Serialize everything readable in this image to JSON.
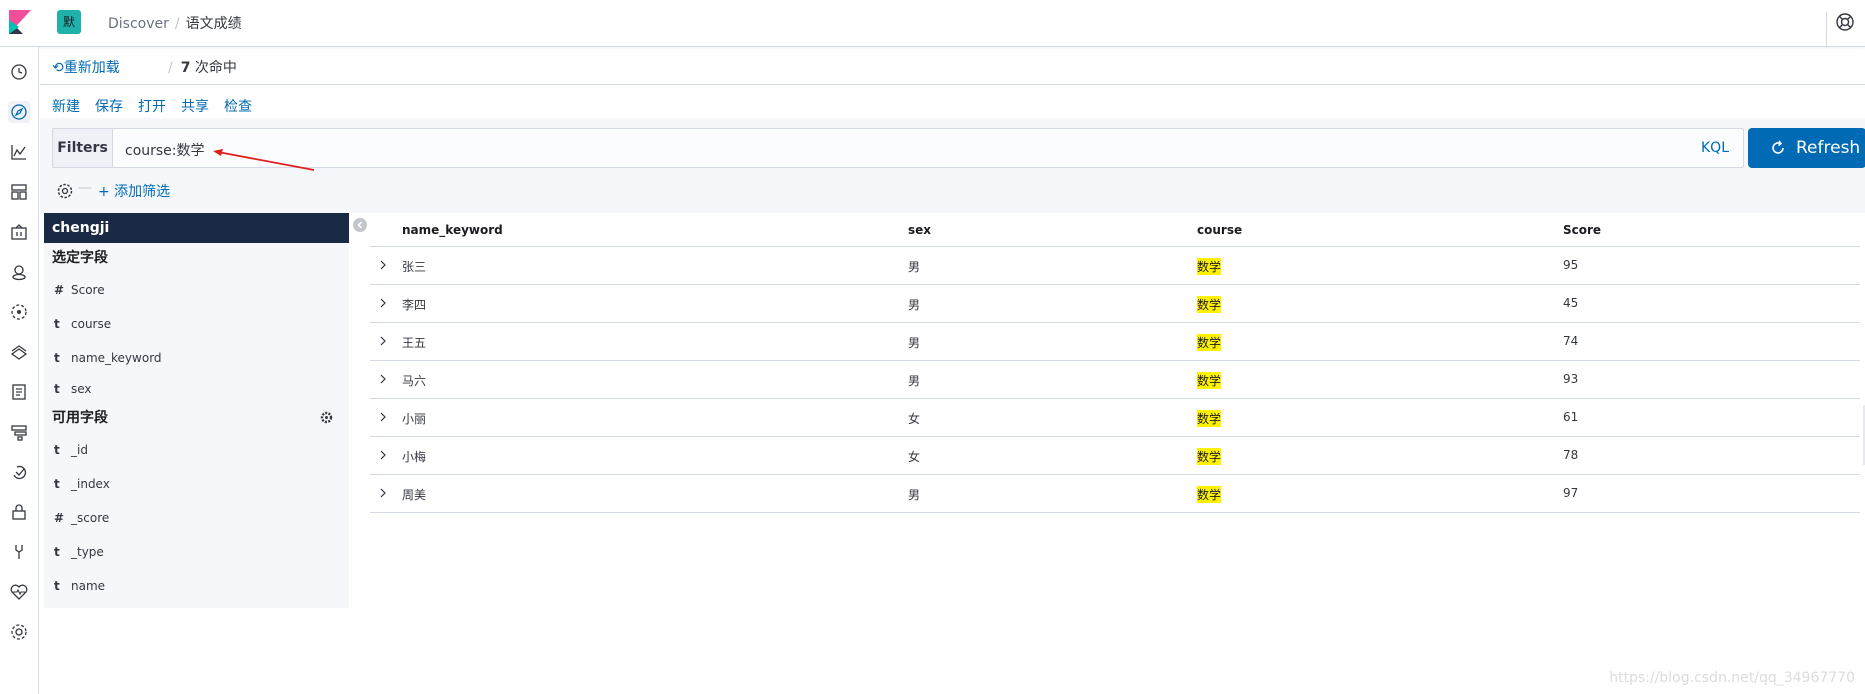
{
  "header": {
    "space_initial": "默",
    "breadcrumbs": [
      "Discover",
      "语文成绩"
    ]
  },
  "nav_icons": [
    "clock-icon",
    "compass-icon",
    "chart-icon",
    "dashboard-icon",
    "canvas-icon",
    "maps-icon",
    "ml-icon",
    "infra-icon",
    "logs-icon",
    "apm-icon",
    "uptime-icon",
    "siem-icon",
    "devtools-icon",
    "monitoring-icon",
    "management-icon"
  ],
  "subheader": {
    "reload": "重新加载",
    "hits_count": "7",
    "hits_label": "次命中"
  },
  "menu": [
    "新建",
    "保存",
    "打开",
    "共享",
    "检查"
  ],
  "query": {
    "filters_label": "Filters",
    "value": "course:数学",
    "language": "KQL",
    "refresh": "Refresh",
    "add_filter": "+ 添加筛选"
  },
  "sidebar": {
    "index_pattern": "chengji",
    "selected_title": "选定字段",
    "selected_fields": [
      {
        "type": "#",
        "name": "Score"
      },
      {
        "type": "t",
        "name": "course"
      },
      {
        "type": "t",
        "name": "name_keyword"
      },
      {
        "type": "t",
        "name": "sex"
      }
    ],
    "available_title": "可用字段",
    "available_fields": [
      {
        "type": "t",
        "name": "_id"
      },
      {
        "type": "t",
        "name": "_index"
      },
      {
        "type": "#",
        "name": "_score"
      },
      {
        "type": "t",
        "name": "_type"
      },
      {
        "type": "t",
        "name": "name"
      }
    ]
  },
  "table": {
    "columns": [
      "name_keyword",
      "sex",
      "course",
      "Score"
    ],
    "rows": [
      [
        "张三",
        "男",
        "数学",
        "95"
      ],
      [
        "李四",
        "男",
        "数学",
        "45"
      ],
      [
        "王五",
        "男",
        "数学",
        "74"
      ],
      [
        "马六",
        "男",
        "数学",
        "93"
      ],
      [
        "小丽",
        "女",
        "数学",
        "61"
      ],
      [
        "小梅",
        "女",
        "数学",
        "78"
      ],
      [
        "周美",
        "男",
        "数学",
        "97"
      ]
    ]
  },
  "watermark": "https://blog.csdn.net/qq_34967770",
  "colors": {
    "accent": "#006bb4",
    "highlight": "#fff200",
    "index_bg": "#1a2a44",
    "annotation": "#e02020"
  }
}
